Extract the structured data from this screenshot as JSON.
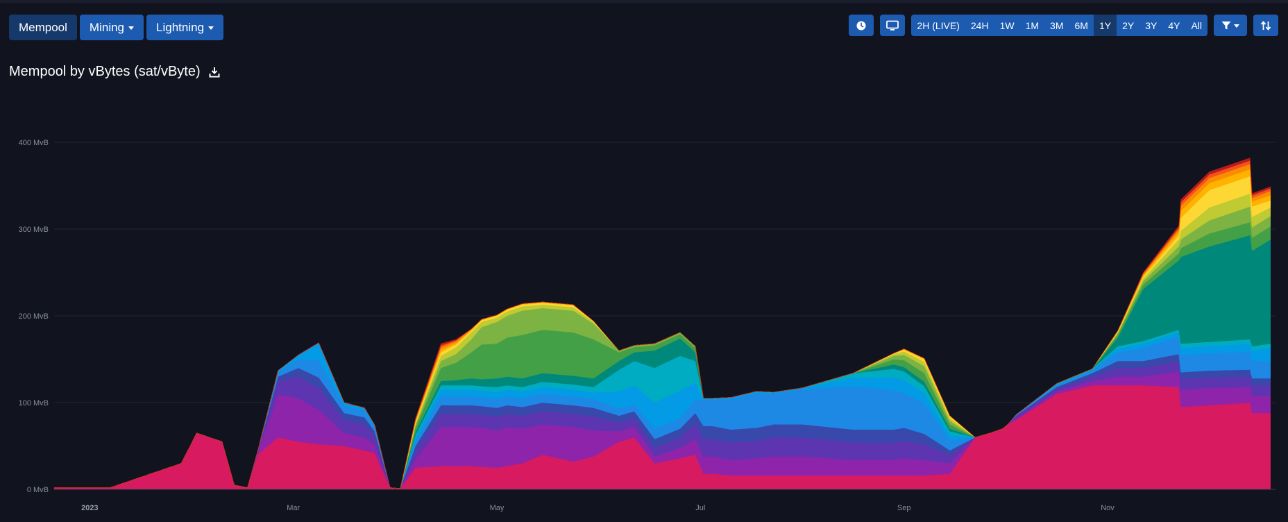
{
  "nav": {
    "mempool_label": "Mempool",
    "mining_label": "Mining",
    "lightning_label": "Lightning"
  },
  "toolbar": {
    "timespans": [
      "2H (LIVE)",
      "24H",
      "1W",
      "1M",
      "3M",
      "6M",
      "1Y",
      "2Y",
      "3Y",
      "4Y",
      "All"
    ],
    "active_timespan": "1Y",
    "icons": [
      "clock-icon",
      "monitor-icon",
      "filter-icon",
      "sort-icon"
    ]
  },
  "page": {
    "title": "Mempool by vBytes (sat/vByte)"
  },
  "colors": {
    "background": "#11131f",
    "button": "#1d5bb1",
    "button_active": "#16396b",
    "bands": [
      "#d81b60",
      "#8e24aa",
      "#5e35b1",
      "#3949ab",
      "#1e88e5",
      "#039be5",
      "#00acc1",
      "#00897b",
      "#43a047",
      "#7cb342",
      "#c0ca33",
      "#fdd835",
      "#ffb300",
      "#fb8c00",
      "#f4511e",
      "#b71c1c"
    ]
  },
  "chart_data": {
    "type": "area",
    "stacked": true,
    "title": "Mempool by vBytes (sat/vByte)",
    "y_unit": "MvB",
    "ylim": [
      0,
      400
    ],
    "yticks": [
      "0 MvB",
      "100 MvB",
      "200 MvB",
      "300 MvB",
      "400 MvB"
    ],
    "xticks": [
      "2023",
      "Mar",
      "May",
      "Jul",
      "Sep",
      "Nov"
    ],
    "xtick_months": [
      0,
      2,
      4,
      6,
      8,
      10
    ],
    "x_range_months": [
      -0.35,
      11.65
    ],
    "grid": true,
    "legend": "none",
    "x": [
      -0.35,
      0.2,
      0.9,
      1.05,
      1.3,
      1.42,
      1.55,
      1.65,
      1.85,
      2.05,
      2.25,
      2.5,
      2.7,
      2.8,
      2.95,
      3.05,
      3.2,
      3.45,
      3.6,
      3.75,
      3.85,
      4.0,
      4.1,
      4.25,
      4.45,
      4.75,
      4.95,
      5.2,
      5.35,
      5.55,
      5.8,
      5.95,
      6.03,
      6.12,
      6.3,
      6.55,
      6.72,
      7.0,
      7.5,
      7.9,
      8.0,
      8.2,
      8.45,
      8.7,
      8.85,
      8.97,
      9.02,
      9.1,
      9.5,
      9.85,
      10.1,
      10.35,
      10.7,
      10.72,
      11.0,
      11.4,
      11.42,
      11.6
    ],
    "series": [
      {
        "values": [
          2,
          2,
          30,
          65,
          55,
          5,
          2,
          40,
          60,
          55,
          52,
          50,
          45,
          42,
          2,
          1,
          25,
          27,
          27,
          27,
          26,
          25,
          27,
          30,
          40,
          32,
          38,
          55,
          60,
          30,
          36,
          40,
          18,
          18,
          16,
          16,
          16,
          16,
          16,
          16,
          16,
          16,
          18,
          60,
          65,
          70,
          75,
          80,
          110,
          120,
          120,
          120,
          118,
          95,
          97,
          100,
          88,
          88
        ]
      },
      {
        "values": [
          0,
          0,
          0,
          0,
          0,
          0,
          0,
          2,
          50,
          50,
          40,
          15,
          15,
          10,
          0,
          0,
          10,
          45,
          45,
          45,
          45,
          43,
          45,
          40,
          35,
          40,
          30,
          12,
          12,
          8,
          12,
          18,
          20,
          20,
          18,
          20,
          22,
          22,
          18,
          18,
          20,
          18,
          12,
          0,
          0,
          0,
          0,
          2,
          3,
          5,
          10,
          10,
          18,
          20,
          20,
          18,
          20,
          20
        ]
      },
      {
        "values": [
          0,
          0,
          0,
          0,
          0,
          0,
          0,
          2,
          15,
          25,
          25,
          15,
          15,
          10,
          0,
          0,
          10,
          15,
          15,
          15,
          15,
          16,
          15,
          15,
          15,
          15,
          16,
          10,
          10,
          10,
          12,
          18,
          20,
          20,
          20,
          20,
          22,
          22,
          20,
          20,
          20,
          18,
          10,
          0,
          0,
          0,
          0,
          2,
          3,
          5,
          10,
          10,
          12,
          12,
          12,
          12,
          12,
          12
        ]
      },
      {
        "values": [
          0,
          0,
          0,
          0,
          0,
          0,
          0,
          0,
          5,
          10,
          12,
          8,
          8,
          5,
          0,
          0,
          5,
          10,
          10,
          10,
          10,
          10,
          10,
          10,
          10,
          10,
          10,
          8,
          8,
          10,
          10,
          12,
          15,
          15,
          15,
          15,
          15,
          15,
          15,
          15,
          15,
          12,
          5,
          0,
          0,
          0,
          0,
          1,
          2,
          4,
          8,
          8,
          8,
          8,
          8,
          8,
          8,
          8
        ]
      },
      {
        "values": [
          0,
          0,
          0,
          0,
          0,
          0,
          0,
          0,
          5,
          10,
          20,
          8,
          8,
          5,
          0,
          0,
          5,
          10,
          10,
          10,
          10,
          10,
          10,
          10,
          10,
          10,
          10,
          8,
          8,
          12,
          12,
          15,
          30,
          30,
          35,
          40,
          35,
          40,
          50,
          45,
          40,
          35,
          12,
          0,
          0,
          0,
          0,
          1,
          2,
          3,
          10,
          15,
          20,
          20,
          20,
          20,
          20,
          20
        ]
      },
      {
        "values": [
          0,
          0,
          0,
          0,
          0,
          0,
          0,
          0,
          2,
          5,
          20,
          4,
          3,
          2,
          0,
          0,
          5,
          8,
          8,
          8,
          8,
          8,
          8,
          8,
          8,
          8,
          8,
          20,
          22,
          30,
          32,
          20,
          2,
          2,
          2,
          2,
          2,
          2,
          10,
          15,
          15,
          12,
          5,
          0,
          0,
          0,
          0,
          0,
          1,
          1,
          4,
          5,
          5,
          8,
          8,
          10,
          12,
          15
        ]
      },
      {
        "values": [
          0,
          0,
          0,
          0,
          0,
          0,
          0,
          0,
          0,
          0,
          0,
          0,
          0,
          0,
          0,
          0,
          3,
          5,
          5,
          5,
          5,
          6,
          5,
          5,
          6,
          6,
          6,
          25,
          28,
          40,
          40,
          25,
          0,
          0,
          0,
          0,
          0,
          0,
          5,
          10,
          10,
          8,
          5,
          0,
          0,
          0,
          0,
          0,
          1,
          1,
          3,
          3,
          3,
          5,
          5,
          5,
          5,
          5
        ]
      },
      {
        "values": [
          0,
          0,
          0,
          0,
          0,
          0,
          0,
          0,
          0,
          0,
          0,
          0,
          0,
          0,
          0,
          0,
          3,
          5,
          6,
          8,
          8,
          10,
          10,
          10,
          10,
          10,
          10,
          10,
          10,
          20,
          20,
          10,
          0,
          0,
          0,
          0,
          0,
          0,
          0,
          5,
          5,
          5,
          3,
          0,
          0,
          0,
          0,
          0,
          0,
          0,
          10,
          60,
          80,
          100,
          110,
          120,
          110,
          120
        ]
      },
      {
        "values": [
          0,
          0,
          0,
          0,
          0,
          0,
          0,
          0,
          0,
          0,
          0,
          0,
          0,
          0,
          0,
          0,
          5,
          15,
          20,
          30,
          40,
          40,
          45,
          50,
          50,
          50,
          45,
          10,
          6,
          6,
          5,
          5,
          0,
          0,
          0,
          0,
          0,
          0,
          0,
          6,
          8,
          10,
          5,
          0,
          0,
          0,
          0,
          0,
          0,
          0,
          3,
          5,
          8,
          10,
          15,
          15,
          15,
          15
        ]
      },
      {
        "values": [
          0,
          0,
          0,
          0,
          0,
          0,
          0,
          0,
          0,
          0,
          0,
          0,
          0,
          0,
          0,
          0,
          3,
          8,
          10,
          15,
          20,
          25,
          25,
          28,
          25,
          25,
          18,
          2,
          2,
          2,
          2,
          2,
          0,
          0,
          0,
          0,
          0,
          0,
          0,
          4,
          6,
          8,
          4,
          0,
          0,
          0,
          0,
          0,
          0,
          0,
          2,
          4,
          8,
          10,
          15,
          18,
          12,
          12
        ]
      },
      {
        "values": [
          0,
          0,
          0,
          0,
          0,
          0,
          0,
          0,
          0,
          0,
          0,
          0,
          0,
          0,
          0,
          0,
          2,
          6,
          8,
          8,
          6,
          5,
          5,
          5,
          4,
          4,
          2,
          0,
          0,
          0,
          0,
          0,
          0,
          0,
          0,
          0,
          0,
          0,
          0,
          2,
          4,
          5,
          3,
          0,
          0,
          0,
          0,
          0,
          0,
          0,
          1,
          3,
          8,
          10,
          15,
          15,
          12,
          10
        ]
      },
      {
        "values": [
          0,
          0,
          0,
          0,
          0,
          0,
          0,
          0,
          0,
          0,
          0,
          0,
          0,
          0,
          0,
          0,
          2,
          4,
          3,
          2,
          2,
          2,
          2,
          2,
          2,
          2,
          1,
          0,
          0,
          0,
          0,
          0,
          0,
          0,
          0,
          0,
          0,
          0,
          0,
          1,
          2,
          3,
          2,
          0,
          0,
          0,
          0,
          0,
          0,
          0,
          1,
          2,
          5,
          15,
          20,
          20,
          12,
          8
        ]
      },
      {
        "values": [
          0,
          0,
          0,
          0,
          0,
          0,
          0,
          0,
          0,
          0,
          0,
          0,
          0,
          0,
          0,
          0,
          1,
          3,
          2,
          1,
          1,
          1,
          1,
          1,
          1,
          1,
          0,
          0,
          0,
          0,
          0,
          0,
          0,
          0,
          0,
          0,
          0,
          0,
          0,
          0,
          1,
          1,
          1,
          0,
          0,
          0,
          0,
          0,
          0,
          0,
          1,
          2,
          4,
          8,
          8,
          8,
          6,
          6
        ]
      },
      {
        "values": [
          0,
          0,
          0,
          0,
          0,
          0,
          0,
          0,
          0,
          0,
          0,
          0,
          0,
          0,
          0,
          0,
          1,
          3,
          2,
          1,
          0,
          0,
          0,
          0,
          0,
          0,
          0,
          0,
          0,
          0,
          0,
          0,
          0,
          0,
          0,
          0,
          0,
          0,
          0,
          0,
          0,
          0,
          0,
          0,
          0,
          0,
          0,
          0,
          0,
          0,
          0,
          1,
          3,
          6,
          6,
          6,
          4,
          5
        ]
      },
      {
        "values": [
          0,
          0,
          0,
          0,
          0,
          0,
          0,
          0,
          0,
          0,
          0,
          0,
          0,
          0,
          0,
          0,
          1,
          2,
          1,
          0,
          0,
          0,
          0,
          0,
          0,
          0,
          0,
          0,
          0,
          0,
          0,
          0,
          0,
          0,
          0,
          0,
          0,
          0,
          0,
          0,
          0,
          0,
          0,
          0,
          0,
          0,
          0,
          0,
          0,
          0,
          0,
          1,
          2,
          4,
          4,
          4,
          3,
          3
        ]
      },
      {
        "values": [
          0,
          0,
          0,
          0,
          0,
          0,
          0,
          0,
          0,
          0,
          0,
          0,
          0,
          0,
          0,
          0,
          1,
          2,
          1,
          0,
          0,
          0,
          0,
          0,
          0,
          0,
          0,
          0,
          0,
          0,
          0,
          0,
          0,
          0,
          0,
          0,
          0,
          0,
          0,
          0,
          0,
          0,
          0,
          0,
          0,
          0,
          0,
          0,
          0,
          0,
          0,
          1,
          2,
          3,
          3,
          3,
          2,
          2
        ]
      }
    ]
  }
}
